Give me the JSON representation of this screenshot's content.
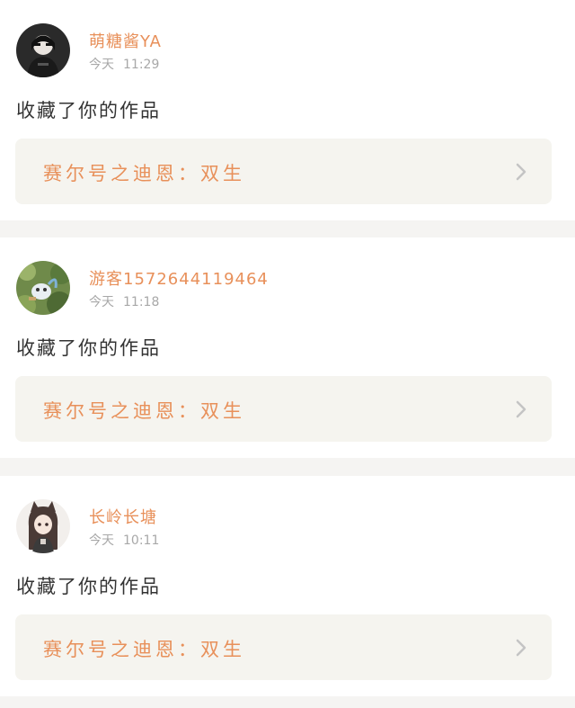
{
  "feed": {
    "items": [
      {
        "username": "萌糖酱YA",
        "time_day": "今天",
        "time_clock": "11:29",
        "action": "收藏了你的作品",
        "work_title": "赛尔号之迪恩：双生",
        "avatar_icon": "avatar-dark-portrait"
      },
      {
        "username": "游客1572644119464",
        "time_day": "今天",
        "time_clock": "11:18",
        "action": "收藏了你的作品",
        "work_title": "赛尔号之迪恩：双生",
        "avatar_icon": "avatar-nature-creature"
      },
      {
        "username": "长岭长塘",
        "time_day": "今天",
        "time_clock": "10:11",
        "action": "收藏了你的作品",
        "work_title": "赛尔号之迪恩：双生",
        "avatar_icon": "avatar-anime-girl"
      }
    ]
  },
  "colors": {
    "accent": "#e8905a",
    "page_background": "#f5f4f2",
    "card_background": "#ffffff",
    "work_box_background": "#f5f4ef",
    "secondary_text": "#a8a8a8",
    "primary_text": "#333333",
    "chevron": "#c4c4c4"
  }
}
